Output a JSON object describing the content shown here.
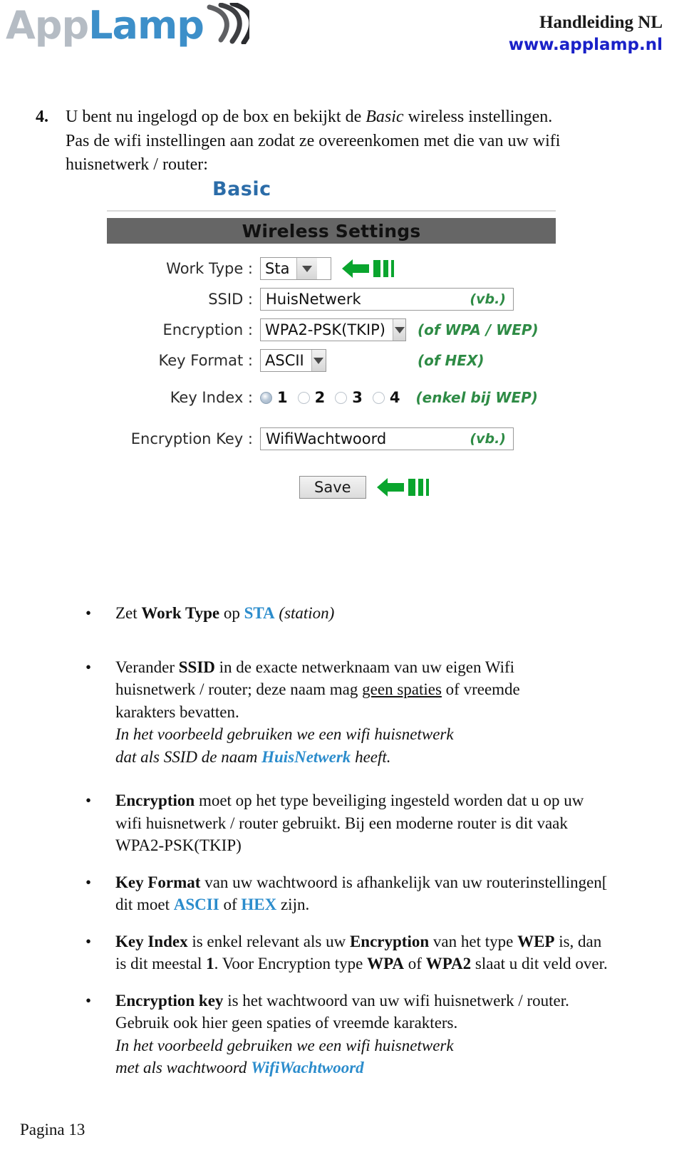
{
  "header": {
    "logo_app": "App",
    "logo_lamp": "Lamp",
    "logo_waves_icon": "wifi-waves-icon",
    "title": "Handleiding NL",
    "url": "www.applamp.nl",
    "brand_blue": "#3d8fc9",
    "url_blue": "#1a21c8"
  },
  "step": {
    "number": "4.",
    "line1_a": "U bent nu ingelogd op de box en bekijkt de ",
    "line1_em": "Basic",
    "line1_b": " wireless instellingen.",
    "line2": "Pas de wifi instellingen aan zodat ze overeenkomen met die van  uw wifi",
    "line3": "huisnetwerk / router:"
  },
  "router": {
    "panel_title": "Basic",
    "section_header": "Wireless Settings",
    "fields": {
      "work_type_label": "Work Type :",
      "work_type_value": "Sta",
      "ssid_label": "SSID :",
      "ssid_value": "HuisNetwerk",
      "ssid_hint": "(vb.)",
      "encryption_label": "Encryption :",
      "encryption_value": "WPA2-PSK(TKIP)",
      "encryption_hint": "(of WPA / WEP)",
      "key_format_label": "Key Format :",
      "key_format_value": "ASCII",
      "key_format_hint": "(of HEX)",
      "key_index_label": "Key Index :",
      "key_index_options": [
        "1",
        "2",
        "3",
        "4"
      ],
      "key_index_selected": "1",
      "key_index_hint": "(enkel bij WEP)",
      "encryption_key_label": "Encryption Key :",
      "encryption_key_value": "WifiWachtwoord",
      "encryption_key_hint": "(vb.)"
    },
    "save_label": "Save",
    "marker_icon": "green-left-arrow-icon",
    "marker_color": "#0aa52e",
    "header_bar_color": "#666666",
    "hint_color": "#2e8b45",
    "panel_title_color": "#2b6ca8"
  },
  "bullets": [
    {
      "marker": "•",
      "html": "Zet <b>Work Type</b> op <span class=\"blue-b\">STA</span> <i>(station)</i>"
    },
    {
      "marker": "•",
      "html": "Verander <b>SSID</b> in de exacte netwerknaam van uw eigen Wifi<br>huisnetwerk / router; deze naam mag <span class=\"under\">geen spaties</span> of vreemde<br>karakters bevatten.<br><i>In het voorbeeld gebruiken we een wifi huisnetwerk</i><br><i>dat als SSID de naam <span class=\"blue-b\">HuisNetwerk</span> heeft.</i>"
    },
    {
      "marker": "•",
      "html": "<b>Encryption</b> moet op het type beveiliging ingesteld worden dat u op uw<br>wifi huisnetwerk / router gebruikt. Bij een moderne router is dit vaak<br>WPA2-PSK(TKIP)"
    },
    {
      "marker": "•",
      "html": "<b>Key Format</b> van uw wachtwoord is afhankelijk van uw routerinstellingen[<br>dit moet <span class=\"blue-b\">ASCII</span> of <span class=\"blue-b\">HEX</span> zijn."
    },
    {
      "marker": "•",
      "html": "<b>Key Index</b> is enkel relevant als uw  <b>Encryption</b>  van het type <b>WEP</b> is, dan<br>is dit meestal <b>1</b>. Voor Encryption type <b>WPA</b> of <b>WPA2</b> slaat u dit veld over."
    },
    {
      "marker": "•",
      "html": "<b>Encryption key</b> is het  wachtwoord van uw wifi huisnetwerk / router.<br>Gebruik ook hier geen spaties of vreemde karakters.<br><i>In het voorbeeld gebruiken we een wifi huisnetwerk</i><br><i>met als wachtwoord  <span class=\"blue-b\">WifiWachtwoord</span></i>"
    }
  ],
  "footer": {
    "page_label": "Pagina 13"
  }
}
